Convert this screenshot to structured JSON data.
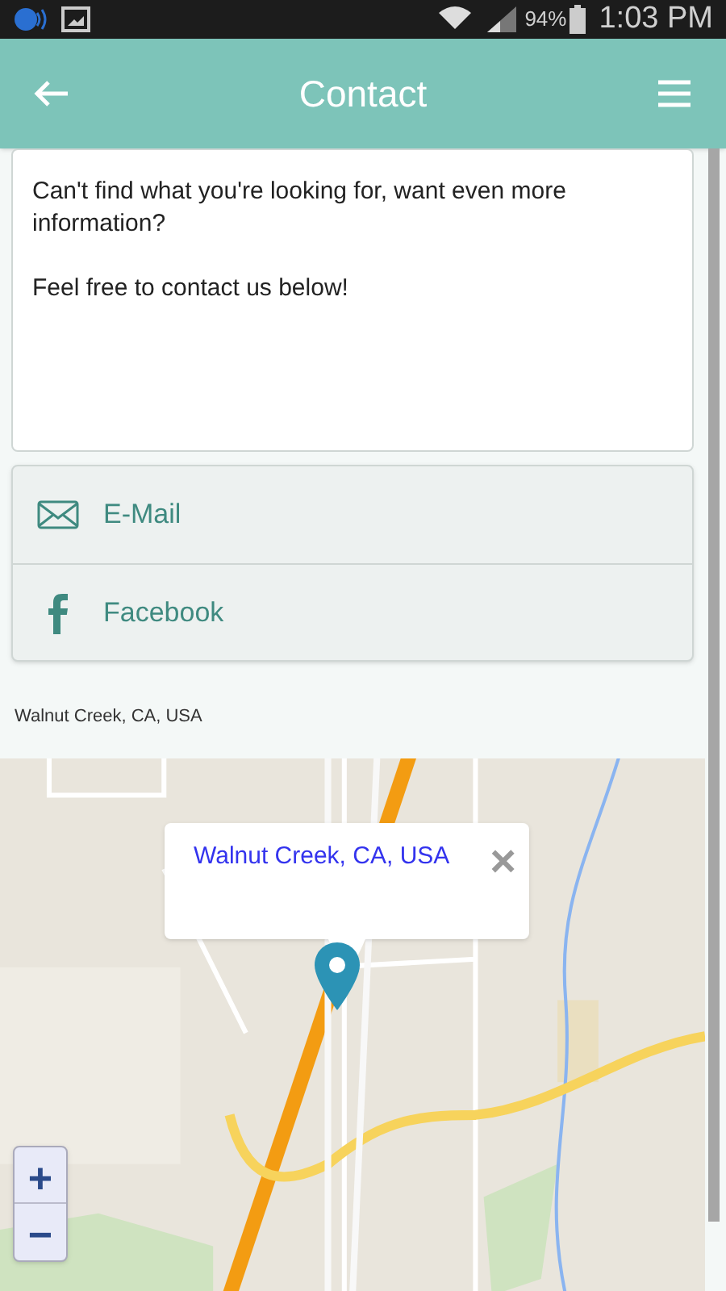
{
  "status_bar": {
    "battery": "94%",
    "time": "1:03 PM"
  },
  "app_bar": {
    "title": "Contact"
  },
  "intro": {
    "paragraphs": [
      "Can't find what you're looking for, want even more information?",
      "Feel free to contact us below!"
    ]
  },
  "links": [
    {
      "kind": "email",
      "label": "E-Mail"
    },
    {
      "kind": "facebook",
      "label": "Facebook"
    }
  ],
  "location": "Walnut Creek, CA, USA",
  "map": {
    "kind": "picture",
    "popup": {
      "title": "Walnut Creek, CA, USA",
      "close": "×"
    },
    "zoom_in": "+",
    "zoom_out": "−"
  }
}
